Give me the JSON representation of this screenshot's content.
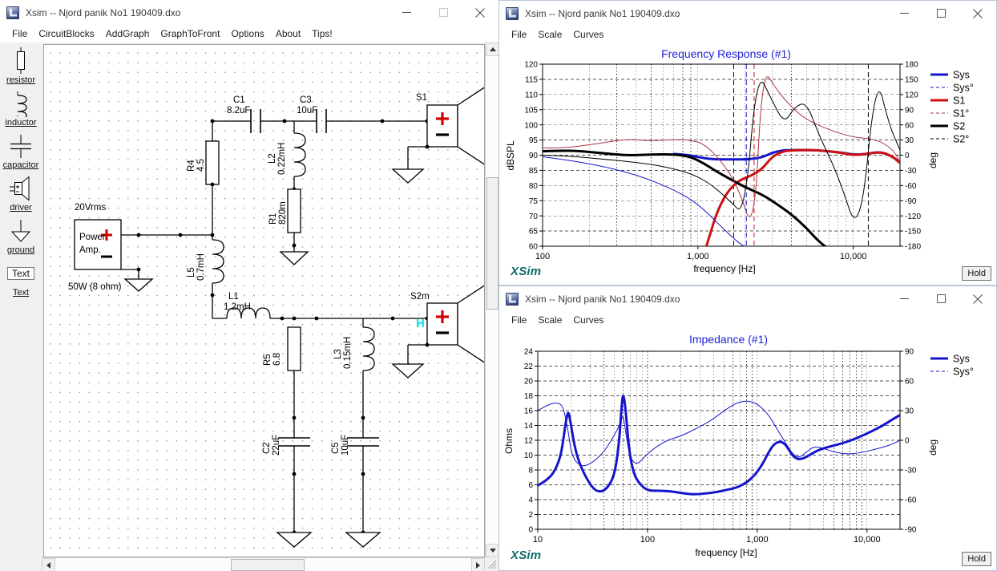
{
  "schematic_window": {
    "title": "Xsim -- Njord panik No1 190409.dxo",
    "icon": "xsim-app-icon",
    "controls": {
      "minimize": "—",
      "maximize": "□",
      "close": "✕"
    },
    "menu": [
      "File",
      "CircuitBlocks",
      "AddGraph",
      "GraphToFront",
      "Options",
      "About",
      "Tips!"
    ],
    "palette": [
      {
        "label": "resistor",
        "icon": "resistor-icon"
      },
      {
        "label": "inductor",
        "icon": "inductor-icon"
      },
      {
        "label": "capacitor",
        "icon": "capacitor-icon"
      },
      {
        "label": "driver",
        "icon": "driver-icon"
      },
      {
        "label": "ground",
        "icon": "ground-icon"
      },
      {
        "label": "Text",
        "icon": "text-box-icon"
      },
      {
        "label": "Text",
        "icon": "text-label-icon"
      }
    ],
    "circuit": {
      "source": {
        "name_top": "20Vrms",
        "line1": "Power",
        "line2": "Amp.",
        "name_bottom": "50W (8 ohm)",
        "plus": "+",
        "minus": "–"
      },
      "components": [
        {
          "ref": "C1",
          "value": "8.2uF",
          "type": "capacitor"
        },
        {
          "ref": "C3",
          "value": "10uF",
          "type": "capacitor"
        },
        {
          "ref": "R4",
          "value": "4.5",
          "type": "resistor"
        },
        {
          "ref": "L2",
          "value": "0.22mH",
          "type": "inductor"
        },
        {
          "ref": "R1",
          "value": "820m",
          "type": "resistor"
        },
        {
          "ref": "L5",
          "value": "0.7mH",
          "type": "inductor"
        },
        {
          "ref": "L1",
          "value": "1.2mH",
          "type": "inductor"
        },
        {
          "ref": "R5",
          "value": "6.8",
          "type": "resistor"
        },
        {
          "ref": "L3",
          "value": "0.15mH",
          "type": "inductor"
        },
        {
          "ref": "C2",
          "value": "22uF",
          "type": "capacitor"
        },
        {
          "ref": "C5",
          "value": "10uF",
          "type": "capacitor"
        }
      ],
      "drivers": [
        {
          "ref": "S1",
          "polarity_plus": "+",
          "polarity_minus": "–"
        },
        {
          "ref": "S2m",
          "polarity_plus": "+",
          "polarity_minus": "–",
          "marker": "H"
        }
      ]
    }
  },
  "freq_window": {
    "title": "Xsim -- Njord panik No1 190409.dxo",
    "menu": [
      "File",
      "Scale",
      "Curves"
    ],
    "logo": "XSim",
    "hold_label": "Hold",
    "controls": {
      "minimize": "—",
      "maximize": "□",
      "close": "✕"
    }
  },
  "imp_window": {
    "title": "Xsim -- Njord panik No1 190409.dxo",
    "menu": [
      "File",
      "Scale",
      "Curves"
    ],
    "logo": "XSim",
    "hold_label": "Hold",
    "controls": {
      "minimize": "—",
      "maximize": "□",
      "close": "✕"
    }
  },
  "chart_data": [
    {
      "id": "frequency-response",
      "type": "line",
      "title": "Frequency Response (#1)",
      "title_color": "#2222dd",
      "xlabel": "frequency [Hz]",
      "ylabel": "dBSPL",
      "y2label": "deg",
      "xscale": "log",
      "xlim": [
        100,
        20000
      ],
      "xticks": [
        100,
        1000,
        10000
      ],
      "xticklabels": [
        "100",
        "1,000",
        "10,000"
      ],
      "ylim": [
        60,
        120
      ],
      "yticks": [
        60,
        65,
        70,
        75,
        80,
        85,
        90,
        95,
        100,
        105,
        110,
        115,
        120
      ],
      "y2lim": [
        -180,
        180
      ],
      "y2ticks": [
        -180,
        -150,
        -120,
        -90,
        -60,
        -30,
        0,
        30,
        60,
        90,
        120,
        150,
        180
      ],
      "grid": true,
      "legend_position": "right",
      "legend": [
        {
          "name": "Sys",
          "color": "#1515cc",
          "style": "solid",
          "width": 3
        },
        {
          "name": "Sys°",
          "color": "#1515cc",
          "style": "dashed",
          "width": 1
        },
        {
          "name": "S1",
          "color": "#cc1111",
          "style": "solid",
          "width": 3
        },
        {
          "name": "S1°",
          "color": "#aa3344",
          "style": "dashed",
          "width": 1
        },
        {
          "name": "S2",
          "color": "#000000",
          "style": "solid",
          "width": 3
        },
        {
          "name": "S2°",
          "color": "#000000",
          "style": "dashed",
          "width": 1
        }
      ],
      "series": [
        {
          "name": "Sys",
          "axis": "left",
          "color": "#1515cc",
          "width": 3,
          "x": [
            700,
            800,
            900,
            1000,
            1200,
            1500,
            1800,
            2200,
            2600,
            3000,
            3500,
            4000,
            5000,
            6000,
            8000,
            10000,
            12000,
            15000,
            18000,
            20000
          ],
          "y": [
            90.4,
            90.2,
            89.9,
            89.4,
            88.7,
            88.6,
            88.6,
            88.7,
            89.3,
            90.8,
            91.6,
            91.7,
            91.7,
            91.6,
            91.0,
            90.2,
            90.3,
            91.2,
            89.5,
            87.5
          ]
        },
        {
          "name": "S1",
          "axis": "left",
          "color": "#cc1111",
          "width": 3,
          "x": [
            1100,
            1200,
            1300,
            1500,
            1800,
            2200,
            2600,
            3000,
            3500,
            4000,
            5000,
            6000,
            8000,
            10000,
            12000,
            15000,
            18000,
            20000
          ],
          "y": [
            58,
            64,
            70,
            77,
            81.5,
            83.2,
            85.5,
            89.5,
            91.2,
            91.6,
            91.7,
            91.6,
            91.0,
            90.0,
            90.3,
            91.2,
            89.5,
            87.4
          ]
        },
        {
          "name": "S2",
          "axis": "left",
          "color": "#000000",
          "width": 3,
          "x": [
            100,
            130,
            170,
            250,
            350,
            500,
            700,
            900,
            1100,
            1300,
            1600,
            2000,
            2600,
            3200,
            4000,
            5000,
            6000,
            7000,
            8000
          ],
          "y": [
            91.3,
            91.5,
            91.4,
            90.6,
            89.9,
            90.2,
            90.3,
            89.5,
            87.2,
            84.8,
            82.2,
            79.5,
            77.0,
            74.0,
            70.5,
            66.0,
            61.5,
            59.0,
            57.0
          ]
        },
        {
          "name": "S1deg",
          "axis": "right",
          "color": "#aa3344",
          "width": 1,
          "style": "solid",
          "x": [
            100,
            150,
            250,
            350,
            500,
            700,
            900,
            1100,
            1400,
            1800,
            2300,
            2600,
            3200,
            4000,
            5000,
            7000,
            10000,
            14000,
            18000,
            20000
          ],
          "y": [
            14,
            15,
            25,
            32,
            28,
            31,
            30,
            22,
            -10,
            -60,
            -160,
            175,
            130,
            95,
            70,
            50,
            35,
            32,
            12,
            -14
          ]
        },
        {
          "name": "S2deg",
          "axis": "right",
          "color": "#000000",
          "width": 1,
          "style": "solid",
          "x": [
            100,
            150,
            250,
            400,
            600,
            900,
            1200,
            1600,
            2000,
            2400,
            3000,
            3600,
            4200,
            5000,
            6000,
            8000,
            11000,
            14000,
            17000,
            20000
          ],
          "y": [
            0,
            -2,
            -8,
            -14,
            -22,
            -36,
            -56,
            -90,
            -120,
            170,
            108,
            62,
            96,
            105,
            40,
            -40,
            -170,
            165,
            60,
            10
          ]
        },
        {
          "name": "Sysdeg",
          "axis": "right",
          "color": "#1515cc",
          "width": 1,
          "x": [
            100,
            200,
            400,
            700,
            1000,
            1400,
            1800,
            2100
          ],
          "y": [
            -3,
            -16,
            -38,
            -68,
            -96,
            -140,
            -172,
            -185
          ]
        }
      ],
      "vertical_markers": [
        {
          "x": 1700,
          "color": "#000000",
          "style": "dashed"
        },
        {
          "x": 2050,
          "color": "#1515cc",
          "style": "dashed"
        },
        {
          "x": 2300,
          "color": "#cc1111",
          "style": "dashed"
        },
        {
          "x": 12500,
          "color": "#000000",
          "style": "dashed"
        }
      ]
    },
    {
      "id": "impedance",
      "type": "line",
      "title": "Impedance (#1)",
      "title_color": "#2222dd",
      "xlabel": "frequency [Hz]",
      "ylabel": "Ohms",
      "y2label": "deg",
      "xscale": "log",
      "xlim": [
        10,
        20000
      ],
      "xticks": [
        10,
        100,
        1000,
        10000
      ],
      "xticklabels": [
        "10",
        "100",
        "1,000",
        "10,000"
      ],
      "ylim": [
        0,
        24
      ],
      "yticks": [
        0,
        2,
        4,
        6,
        8,
        10,
        12,
        14,
        16,
        18,
        20,
        22,
        24
      ],
      "y2lim": [
        -90,
        90
      ],
      "y2ticks": [
        -90,
        -60,
        -30,
        0,
        30,
        60,
        90
      ],
      "grid": true,
      "legend_position": "right",
      "legend": [
        {
          "name": "Sys",
          "color": "#1515cc",
          "style": "solid",
          "width": 3
        },
        {
          "name": "Sys°",
          "color": "#1515cc",
          "style": "dashed",
          "width": 1
        }
      ],
      "series": [
        {
          "name": "Sys",
          "axis": "left",
          "color": "#1515cc",
          "width": 3,
          "x": [
            10,
            12,
            14,
            16,
            17,
            18,
            19,
            20,
            22,
            25,
            30,
            35,
            42,
            50,
            55,
            58,
            60,
            63,
            68,
            75,
            85,
            100,
            130,
            170,
            200,
            260,
            330,
            420,
            520,
            650,
            800,
            950,
            1100,
            1250,
            1400,
            1600,
            1800,
            2000,
            2200,
            2500,
            3000,
            3500,
            4200,
            5000,
            6000,
            7500,
            9000,
            11000,
            14000,
            17000,
            20000
          ],
          "y": [
            5.9,
            6.6,
            7.6,
            9.6,
            11.8,
            14.5,
            16.1,
            14.2,
            10.6,
            8.2,
            6.0,
            5.0,
            5.3,
            7.2,
            11.5,
            16.5,
            18.5,
            16.4,
            10.5,
            7.4,
            6.1,
            5.2,
            5.2,
            5.1,
            4.9,
            4.7,
            4.8,
            5.0,
            5.3,
            5.6,
            6.3,
            7.3,
            8.6,
            10.2,
            11.4,
            11.9,
            11.5,
            10.4,
            9.6,
            9.4,
            10.0,
            10.6,
            11.0,
            11.3,
            11.6,
            12.1,
            12.6,
            13.2,
            14.0,
            14.8,
            15.4
          ]
        },
        {
          "name": "Sysdeg",
          "axis": "right",
          "color": "#1515cc",
          "width": 1,
          "x": [
            10,
            12,
            14,
            16,
            17,
            18,
            19,
            20,
            22,
            26,
            32,
            40,
            48,
            55,
            58,
            60,
            63,
            68,
            74,
            82,
            95,
            115,
            150,
            200,
            280,
            380,
            500,
            650,
            800,
            950,
            1100,
            1300,
            1500,
            1800,
            2100,
            2400,
            2800,
            3300,
            4000,
            5000,
            6500,
            8500,
            11000,
            14000,
            17000,
            20000
          ],
          "y": [
            30,
            35,
            38,
            37,
            33,
            22,
            8,
            -10,
            -22,
            -27,
            -22,
            -12,
            2,
            14,
            22,
            25,
            10,
            -14,
            -22,
            -24,
            -16,
            -8,
            0,
            4,
            12,
            20,
            30,
            38,
            40,
            38,
            33,
            24,
            12,
            -2,
            -14,
            -18,
            -12,
            -6,
            -8,
            -12,
            -14,
            -13,
            -10,
            -7,
            -4,
            0
          ]
        }
      ]
    }
  ]
}
